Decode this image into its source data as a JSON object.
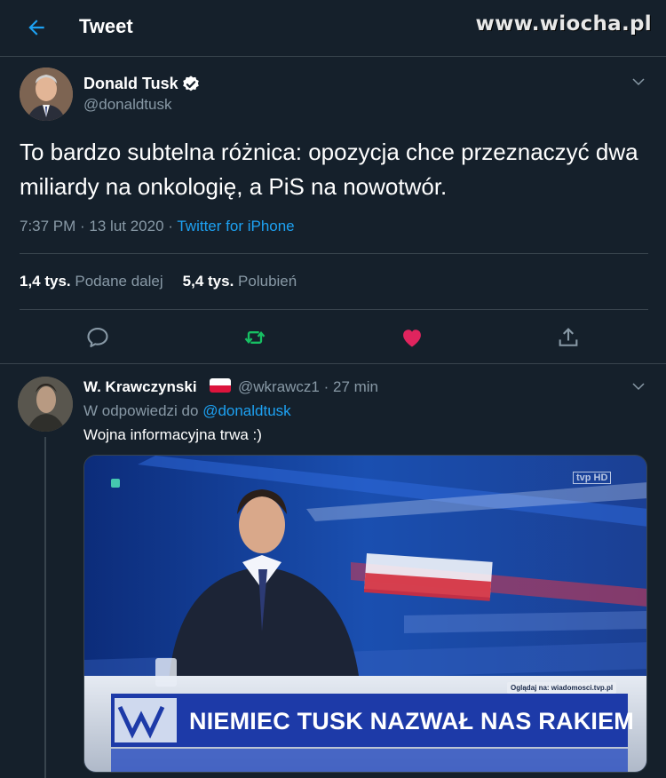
{
  "header": {
    "title": "Tweet",
    "watermark": "www.wiocha.pl"
  },
  "tweet": {
    "author_name": "Donald Tusk",
    "author_handle": "@donaldtusk",
    "text": "To bardzo subtelna różnica: opozycja chce przeznaczyć dwa miliardy na onkologię, a PiS na nowotwór.",
    "time_date": "7:37 PM · 13 lut 2020 · ",
    "source": "Twitter for iPhone",
    "retweets_count": "1,4 tys.",
    "retweets_label": "Podane dalej",
    "likes_count": "5,4 tys.",
    "likes_label": "Polubień"
  },
  "reply": {
    "author_name": "W. Krawczynski",
    "handle_time": "@wkrawcz1 · 27 min",
    "replying_prefix": "W odpowiedzi do ",
    "replying_mention": "@donaldtusk",
    "text": "Wojna informacyjna trwa :)",
    "media": {
      "chyron": "NIEMIEC TUSK  NAZWAŁ  NAS  RAKIEM",
      "site": "Oglądaj na: wiadomosci.tvp.pl",
      "channel_logo": "tvp HD"
    }
  },
  "colors": {
    "background": "#15202b",
    "accent": "#1da1f2",
    "secondary_text": "#8899a6",
    "retweet": "#17bf63",
    "like": "#e0245e",
    "border": "#38444d"
  },
  "icons": [
    "back-arrow-icon",
    "verified-badge-icon",
    "chevron-down-icon",
    "reply-icon",
    "retweet-icon",
    "like-heart-icon",
    "share-icon",
    "poland-flag-icon"
  ]
}
